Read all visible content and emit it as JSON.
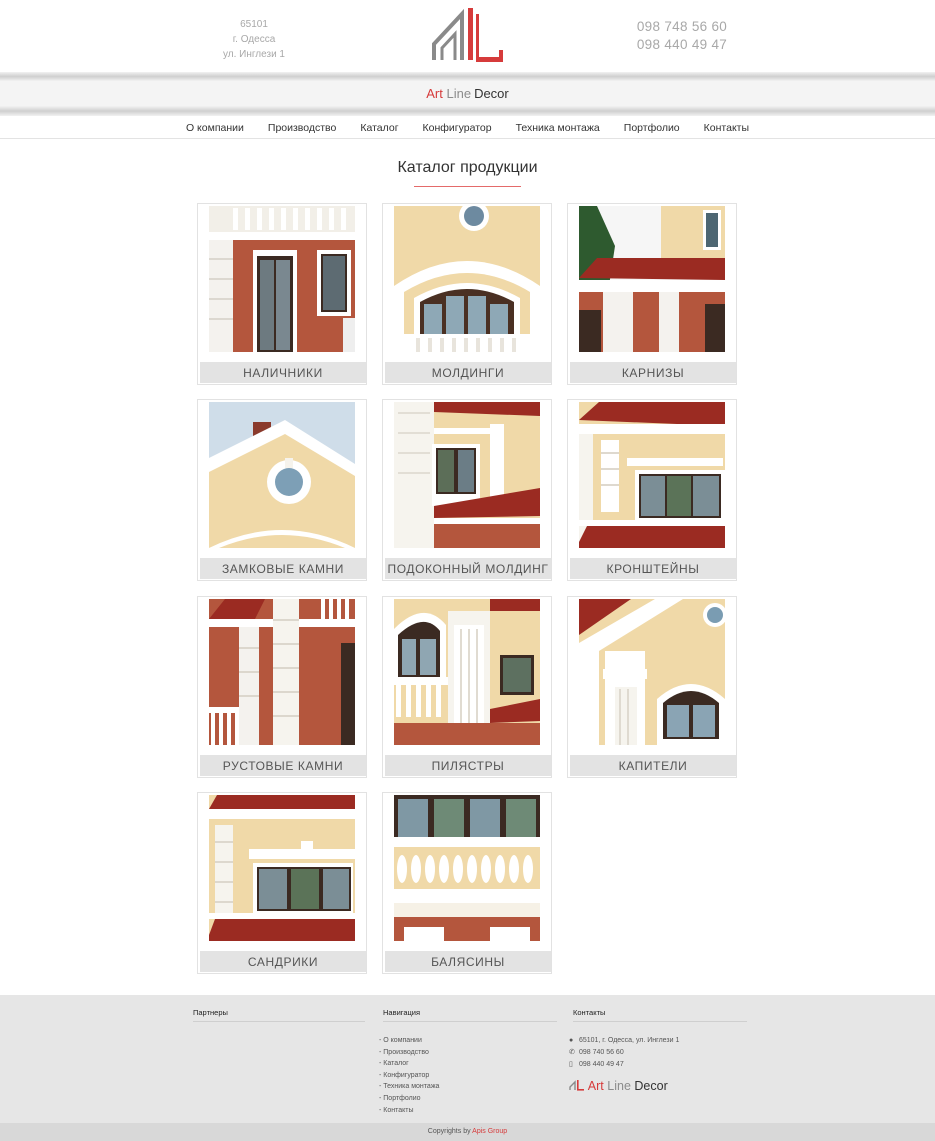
{
  "header": {
    "address": [
      "65101",
      "г. Одесса",
      "ул. Инглези 1"
    ],
    "phones": [
      "098 748 56 60",
      "098 440 49 47"
    ],
    "brand": {
      "part1": "Art",
      "part2": "Line",
      "part3": "Decor"
    }
  },
  "nav": [
    "О компании",
    "Производство",
    "Каталог",
    "Конфигуратор",
    "Техника монтажа",
    "Портфолио",
    "Контакты"
  ],
  "page_title": "Каталог продукции",
  "catalog": [
    {
      "label": "НАЛИЧНИКИ"
    },
    {
      "label": "МОЛДИНГИ"
    },
    {
      "label": "КАРНИЗЫ"
    },
    {
      "label": "ЗАМКОВЫЕ КАМНИ"
    },
    {
      "label": "ПОДОКОННЫЙ МОЛДИНГ"
    },
    {
      "label": "КРОНШТЕЙНЫ"
    },
    {
      "label": "РУСТОВЫЕ КАМНИ"
    },
    {
      "label": "ПИЛЯСТРЫ"
    },
    {
      "label": "КАПИТЕЛИ"
    },
    {
      "label": "САНДРИКИ"
    },
    {
      "label": "БАЛЯСИНЫ"
    }
  ],
  "footer": {
    "partners_title": "Партнеры",
    "nav_title": "Навигация",
    "nav_links": [
      "- О компании",
      "- Производство",
      "- Каталог",
      "- Конфигуратор",
      "- Техника монтажа",
      "- Портфолио",
      "- Контакты"
    ],
    "contacts_title": "Контакты",
    "contact_address": "65101, г. Одесса, ул. Инглези 1",
    "contact_phone1": "098 740 56 60",
    "contact_phone2": "098 440 49 47",
    "copyright_prefix": "Copyrights by",
    "copyright_company": "Apis Group"
  },
  "colors": {
    "accent": "#d63b3b",
    "text": "#333333",
    "muted": "#a8a8a8",
    "footer_bg": "#e6e6e6",
    "caption_bg": "#e3e3e3"
  },
  "icons": [
    "logo-mark",
    "map-marker-icon",
    "phone-icon",
    "mobile-icon"
  ]
}
